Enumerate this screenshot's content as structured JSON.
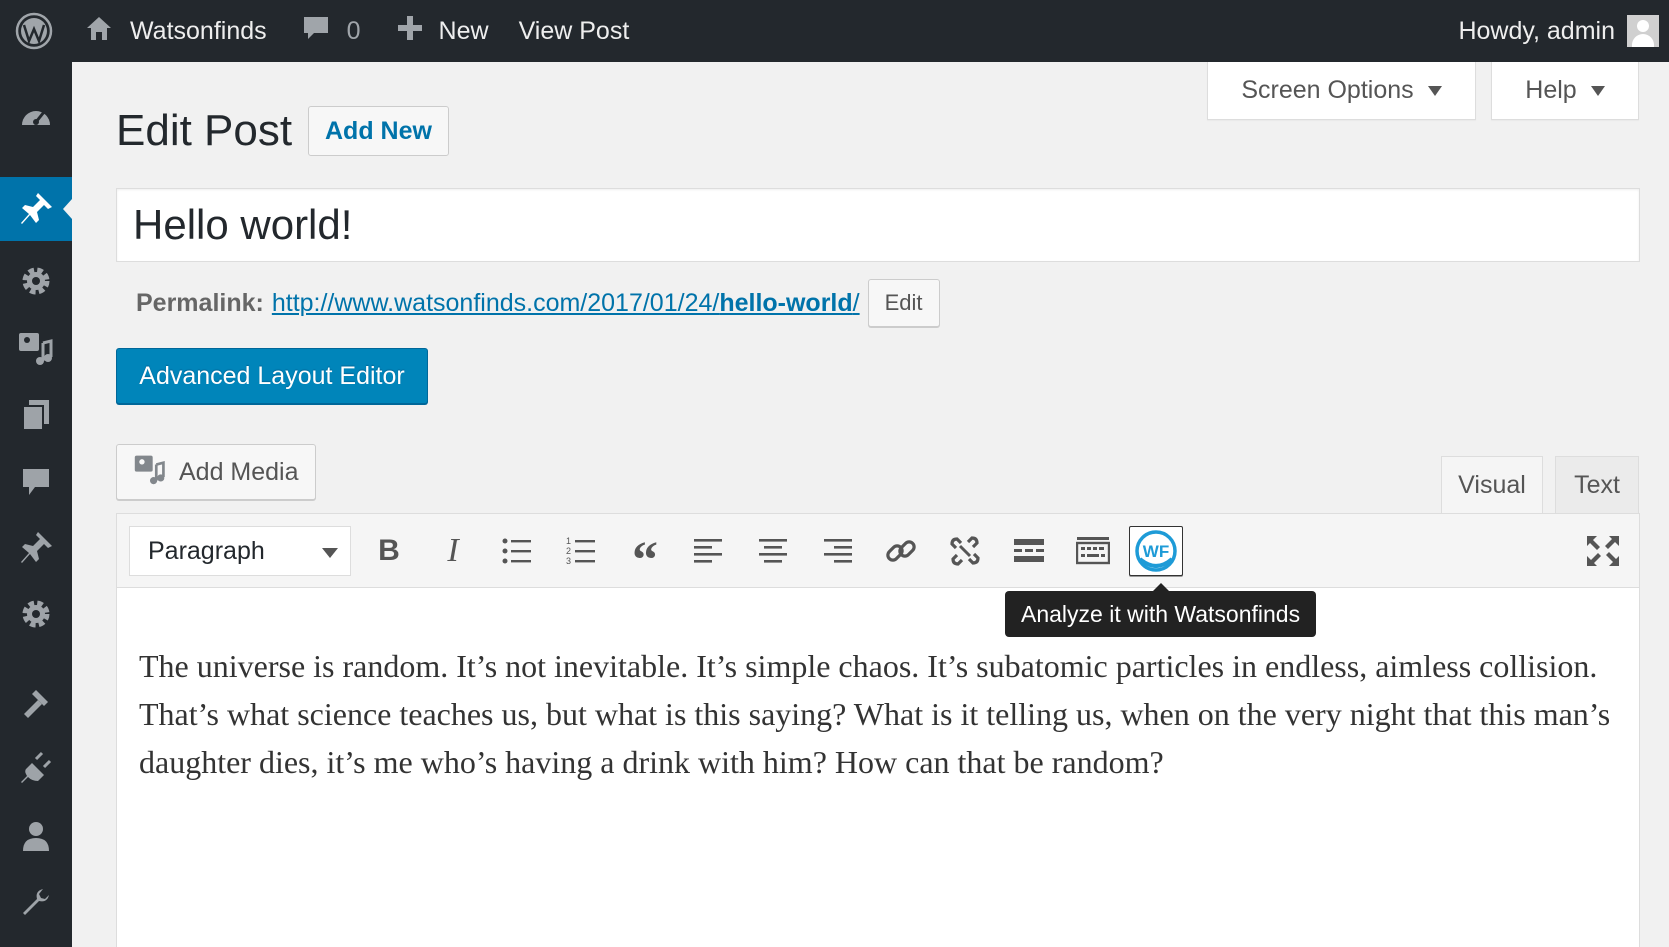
{
  "adminbar": {
    "site_name": "Watsonfinds",
    "comments_count": "0",
    "new_label": "New",
    "view_post_label": "View Post",
    "howdy": "Howdy, admin"
  },
  "sidebar": {
    "items": [
      {
        "icon": "dashboard-icon"
      },
      {
        "icon": "pin-icon",
        "active": true
      },
      {
        "icon": "gear-icon"
      },
      {
        "icon": "media-icon"
      },
      {
        "icon": "pages-icon"
      },
      {
        "icon": "comments-icon"
      },
      {
        "icon": "pin-icon"
      },
      {
        "icon": "gear-icon"
      },
      {
        "icon": "appearance-icon"
      },
      {
        "icon": "plugins-icon"
      },
      {
        "icon": "users-icon"
      },
      {
        "icon": "tools-icon"
      }
    ]
  },
  "screen_options": {
    "label": "Screen Options"
  },
  "help": {
    "label": "Help"
  },
  "page": {
    "title": "Edit Post",
    "add_new": "Add New"
  },
  "post": {
    "title": "Hello world!",
    "permalink_label": "Permalink:",
    "permalink_base": "http://www.watsonfinds.com/2017/01/24/",
    "permalink_slug": "hello-world",
    "permalink_trail": "/",
    "edit_label": "Edit"
  },
  "buttons": {
    "advanced_layout_editor": "Advanced Layout Editor",
    "add_media": "Add Media"
  },
  "editor": {
    "tab_visual": "Visual",
    "tab_text": "Text",
    "format_value": "Paragraph",
    "bold_glyph": "B",
    "italic_glyph": "I",
    "quote_glyph": "“",
    "wf_label": "WF",
    "tooltip": "Analyze it with Watsonfinds",
    "content": "The universe is random. It’s not inevitable. It’s simple chaos. It’s subatomic particles in endless, aimless collision. That’s what science teaches us, but what is this saying? What is it telling us, when on the very night that this man’s daughter dies, it’s me who’s having a drink with him? How can that be random?"
  },
  "colors": {
    "adminbar_bg": "#23282d",
    "accent": "#0073aa",
    "primary_button": "#0085ba",
    "wf_brand": "#1e9bd7"
  }
}
